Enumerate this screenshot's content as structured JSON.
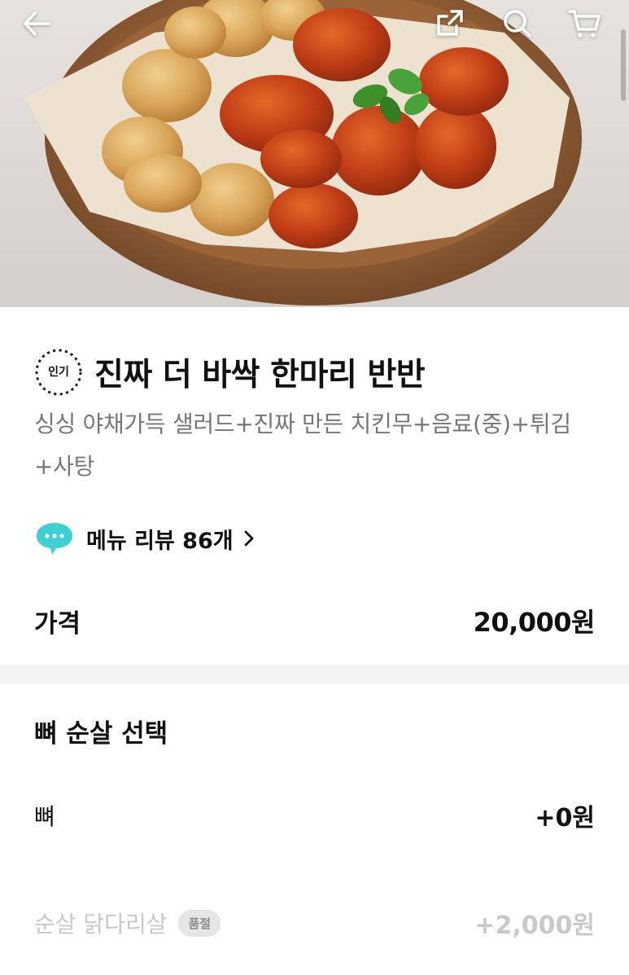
{
  "header": {
    "back_icon": "arrow-left-icon",
    "share_icon": "share-icon",
    "search_icon": "search-icon",
    "cart_icon": "cart-icon"
  },
  "menu": {
    "badge": "인기",
    "title": "진짜 더 바싹 한마리 반반",
    "description": "싱싱 야채가득 샐러드+진짜 만든 치킨무+음료(중)+튀김+사탕",
    "review_link": "메뉴 리뷰 86개",
    "price_label": "가격",
    "price": "20,000원"
  },
  "options": {
    "title": "뼈 순살 선택",
    "items": [
      {
        "name": "뼈",
        "price": "+0원",
        "sold_out": false
      },
      {
        "name": "순살 닭다리살",
        "price": "+2,000원",
        "sold_out": true,
        "badge": "품절"
      }
    ]
  },
  "colors": {
    "review_bubble": "#3fd0d4",
    "divider": "#f2f3f5",
    "disabled_text": "#c9c9c9"
  }
}
